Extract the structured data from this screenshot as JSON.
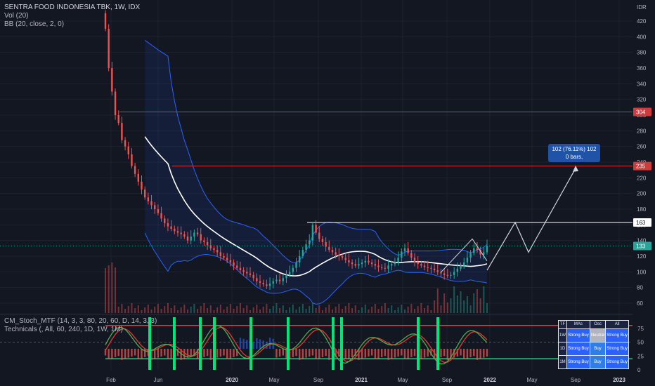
{
  "header": {
    "symbol": "SENTRA FOOD INDONESIA TBK, 1W, IDX",
    "vol_label": "Vol (20)",
    "bb_label": "BB (20, close, 2, 0)",
    "stoch_label": "CM_Stoch_MTF (14, 3, 3, 80, 20, 60, D, 14, 3, 3)",
    "tech_label": "Technicals (, All, 60, 240, 1D, 1W, 1M)"
  },
  "price_axis": {
    "currency": "IDR",
    "ticks": [
      "420",
      "400",
      "380",
      "360",
      "340",
      "320",
      "300",
      "280",
      "260",
      "240",
      "220",
      "200",
      "180",
      "160",
      "140",
      "120",
      "100",
      "80",
      "60"
    ],
    "level_tags": [
      {
        "value": "304",
        "color": "#d13a3a"
      },
      {
        "value": "235",
        "color": "#d13a3a"
      },
      {
        "value": "163",
        "color": "#ffffff"
      },
      {
        "value": "133",
        "color": "#26a69a"
      }
    ]
  },
  "osc_axis": {
    "ticks": [
      "75",
      "50",
      "25",
      "0"
    ]
  },
  "time_axis": {
    "labels": [
      "Feb",
      "Jun",
      "2020",
      "May",
      "Sep",
      "2021",
      "May",
      "Sep",
      "2022",
      "May",
      "Sep",
      "2023"
    ]
  },
  "measure_box": {
    "line1": "102 (76.11%) 102",
    "line2": "0 bars,"
  },
  "tech_table": {
    "headers": [
      "TF",
      "MAs",
      "Osc",
      "All"
    ],
    "rows": [
      {
        "tf": "1W",
        "mas": "Strong Buy",
        "osc": "Neutral",
        "all": "Strong Buy"
      },
      {
        "tf": "1D",
        "mas": "Strong Buy",
        "osc": "Buy",
        "all": "Strong Buy"
      },
      {
        "tf": "1M",
        "mas": "Strong Buy",
        "osc": "Buy",
        "all": "Strong Buy"
      }
    ]
  },
  "colors": {
    "bg": "#131722",
    "up": "#26a69a",
    "down": "#ef5350",
    "bb": "#2962ff",
    "basis": "#ffffff",
    "stoch_k": "#4caf50",
    "stoch_d": "#e53935",
    "signal": "#00e676"
  },
  "chart_data": {
    "type": "candlestick",
    "symbol": "SENTRA FOOD INDONESIA TBK",
    "interval": "1W",
    "exchange": "IDX",
    "currency": "IDR",
    "y_range": [
      40,
      440
    ],
    "levels": [
      304,
      235,
      163,
      133
    ],
    "approx_weekly_close": [
      [
        410,
        360,
        330,
        300,
        290,
        268,
        260,
        250,
        235,
        225,
        215,
        205,
        195,
        190,
        185,
        180,
        175,
        168,
        162,
        158,
        155,
        152
      ],
      [
        150,
        148,
        145,
        140,
        145,
        150,
        148,
        140,
        138,
        134,
        130,
        128,
        125,
        120,
        118,
        115,
        112,
        108,
        105,
        102,
        100,
        98
      ],
      [
        96,
        92,
        88,
        86,
        84,
        82,
        85,
        88,
        90,
        88,
        92,
        96,
        100,
        105,
        112,
        120,
        128,
        135,
        140,
        160,
        150,
        142
      ],
      [
        138,
        132,
        128,
        125,
        122,
        120,
        118,
        115,
        112,
        110,
        108,
        110,
        112,
        114,
        112,
        110,
        108,
        106,
        105,
        104,
        108,
        110
      ],
      [
        112,
        118,
        126,
        130,
        124,
        118,
        112,
        110,
        108,
        106,
        105,
        104,
        102,
        100,
        98,
        96,
        95,
        96,
        100,
        104,
        108,
        112
      ],
      [
        118,
        124,
        130,
        128,
        122,
        125,
        133
      ]
    ],
    "projection": [
      [
        102,
        163
      ],
      [
        125,
        125
      ],
      [
        163,
        163
      ]
    ]
  }
}
